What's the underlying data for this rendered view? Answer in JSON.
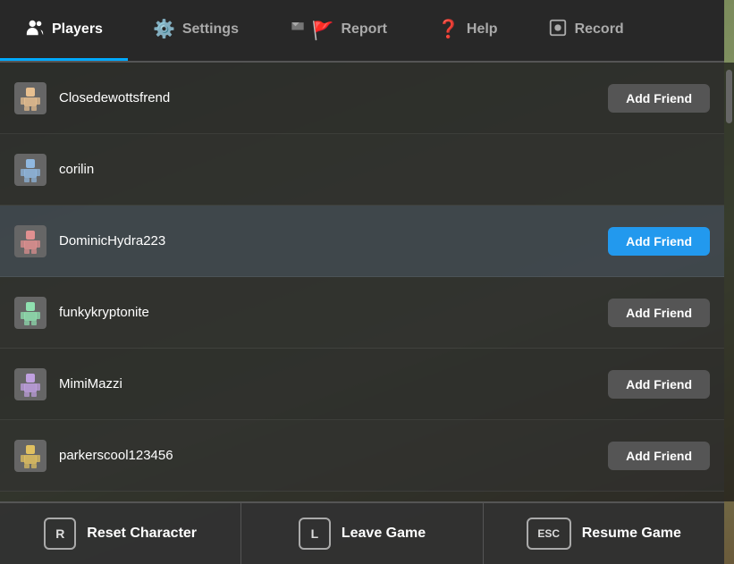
{
  "tabs": [
    {
      "id": "players",
      "label": "Players",
      "icon": "👥",
      "active": true
    },
    {
      "id": "settings",
      "label": "Settings",
      "icon": "⚙️",
      "active": false
    },
    {
      "id": "report",
      "label": "Report",
      "icon": "🚩",
      "active": false
    },
    {
      "id": "help",
      "label": "Help",
      "icon": "❓",
      "active": false
    },
    {
      "id": "record",
      "label": "Record",
      "icon": "⊙",
      "active": false
    }
  ],
  "players": [
    {
      "id": 1,
      "name": "Closedewottsfrend",
      "addFriendLabel": "Add Friend",
      "highlighted": false,
      "btnActive": false
    },
    {
      "id": 2,
      "name": "corilin",
      "addFriendLabel": "",
      "highlighted": false,
      "btnActive": false
    },
    {
      "id": 3,
      "name": "DominicHydra223",
      "addFriendLabel": "Add Friend",
      "highlighted": true,
      "btnActive": true
    },
    {
      "id": 4,
      "name": "funkykryptonite",
      "addFriendLabel": "Add Friend",
      "highlighted": false,
      "btnActive": false
    },
    {
      "id": 5,
      "name": "MimiMazzi",
      "addFriendLabel": "Add Friend",
      "highlighted": false,
      "btnActive": false
    },
    {
      "id": 6,
      "name": "parkerscool123456",
      "addFriendLabel": "Add Friend",
      "highlighted": false,
      "btnActive": false
    }
  ],
  "bottomButtons": [
    {
      "id": "reset",
      "key": "R",
      "label": "Reset Character"
    },
    {
      "id": "leave",
      "key": "L",
      "label": "Leave Game"
    },
    {
      "id": "resume",
      "key": "ESC",
      "label": "Resume Game"
    }
  ]
}
